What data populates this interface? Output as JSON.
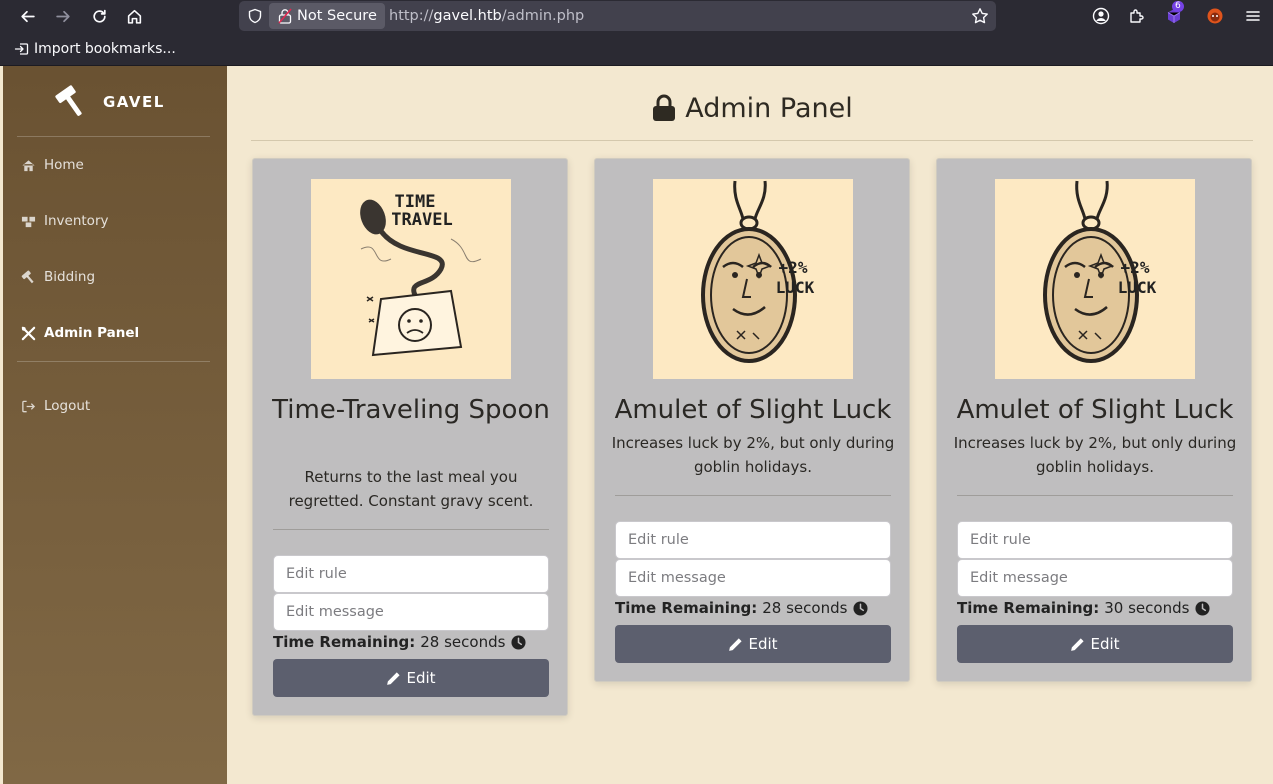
{
  "browser": {
    "security_label": "Not Secure",
    "url_scheme": "http://",
    "url_host": "gavel.htb",
    "url_path": "/admin.php",
    "extension_badge": "6",
    "bookmark_label": "Import bookmarks..."
  },
  "sidebar": {
    "brand": "GAVEL",
    "items": [
      {
        "label": "Home",
        "icon": "home-icon"
      },
      {
        "label": "Inventory",
        "icon": "boxes-icon"
      },
      {
        "label": "Bidding",
        "icon": "gavel-icon"
      },
      {
        "label": "Admin Panel",
        "icon": "tools-icon",
        "active": true
      },
      {
        "label": "Logout",
        "icon": "logout-icon"
      }
    ]
  },
  "page": {
    "title": "Admin Panel"
  },
  "cards": [
    {
      "title": "Time-Traveling Spoon",
      "description": "Returns to the last meal you regretted. Constant gravy scent.",
      "image_text_1": "TIME",
      "image_text_2": "TRAVEL",
      "rule_placeholder": "Edit rule",
      "message_placeholder": "Edit message",
      "time_label": "Time Remaining:",
      "time_value": "28 seconds",
      "button_label": "Edit"
    },
    {
      "title": "Amulet of Slight Luck",
      "description": "Increases luck by 2%, but only during goblin holidays.",
      "image_text_1": "+2%",
      "image_text_2": "LUCK",
      "rule_placeholder": "Edit rule",
      "message_placeholder": "Edit message",
      "time_label": "Time Remaining:",
      "time_value": "28 seconds",
      "button_label": "Edit"
    },
    {
      "title": "Amulet of Slight Luck",
      "description": "Increases luck by 2%, but only during goblin holidays.",
      "image_text_1": "+2%",
      "image_text_2": "LUCK",
      "rule_placeholder": "Edit rule",
      "message_placeholder": "Edit message",
      "time_label": "Time Remaining:",
      "time_value": "30 seconds",
      "button_label": "Edit"
    }
  ],
  "colors": {
    "page_bg": "#f3e8d0",
    "sidebar_top": "#6a5232",
    "sidebar_bottom": "#806845",
    "card_bg": "#bfbebf",
    "button_bg": "#5c5f6e"
  }
}
